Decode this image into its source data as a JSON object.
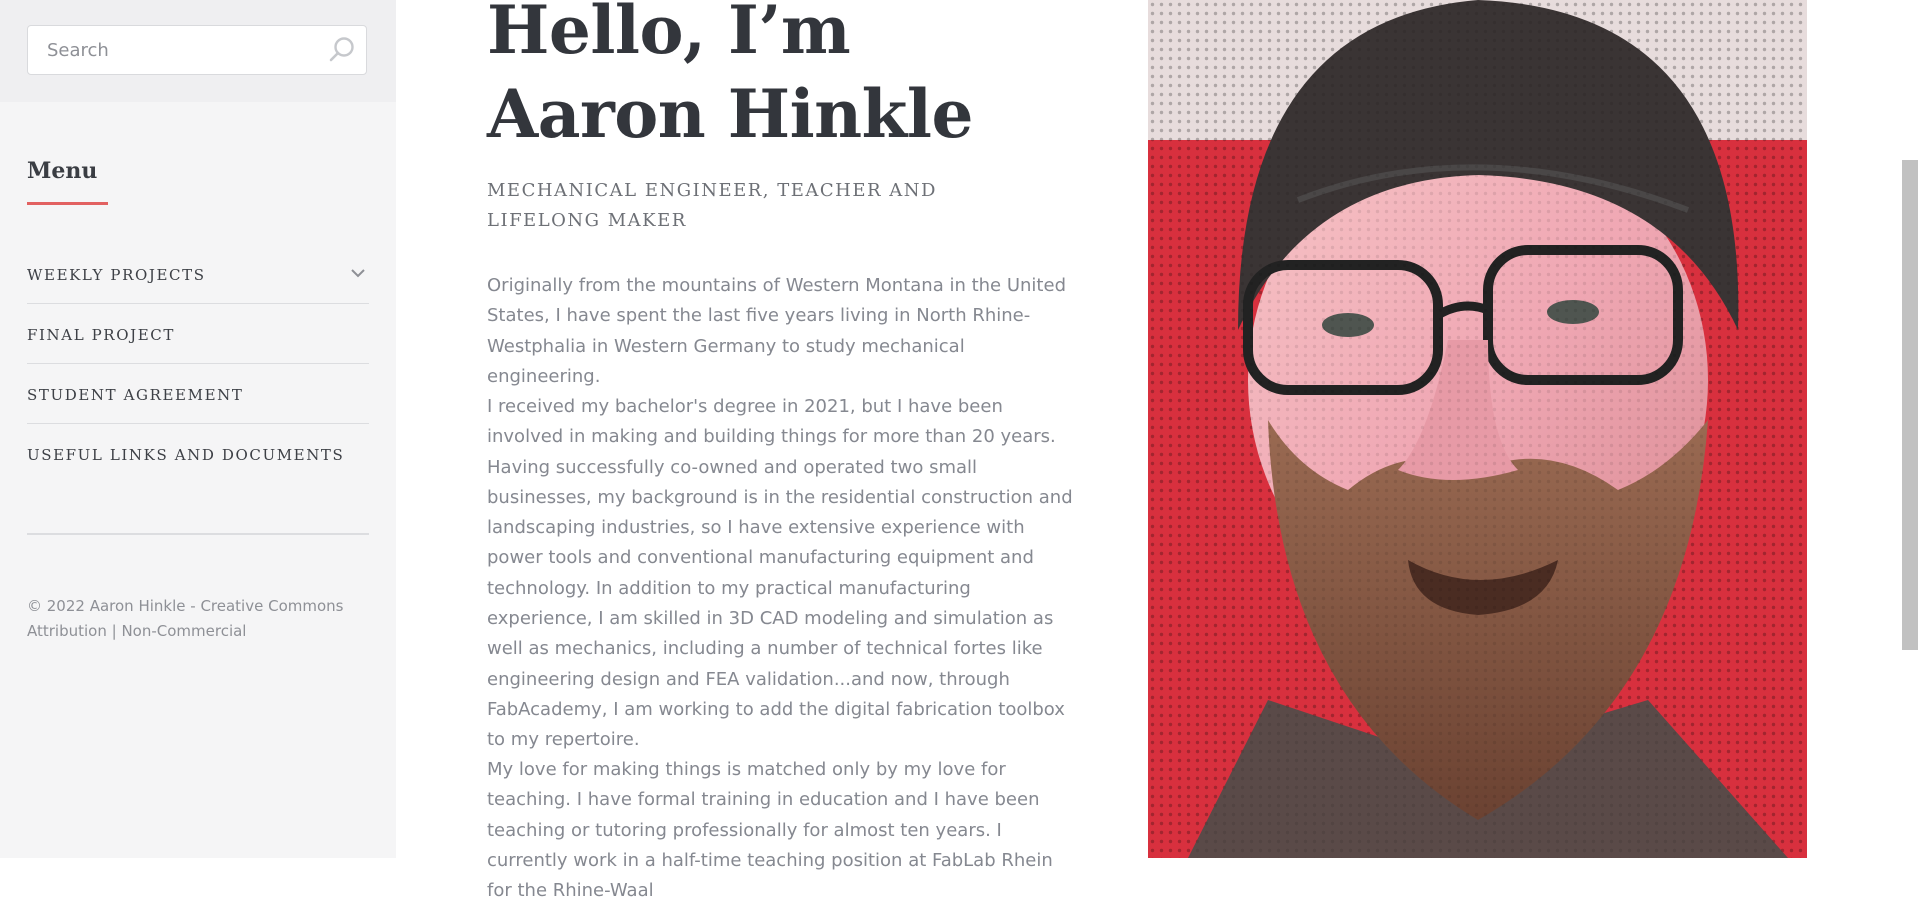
{
  "search": {
    "placeholder": "Search"
  },
  "sidebar": {
    "menu_heading": "Menu",
    "items": [
      {
        "label": "WEEKLY PROJECTS",
        "has_submenu": true,
        "icon": "chevron-down-icon"
      },
      {
        "label": "FINAL PROJECT"
      },
      {
        "label": "STUDENT AGREEMENT"
      },
      {
        "label": "USEFUL LINKS AND DOCUMENTS"
      }
    ],
    "footer": "© 2022 Aaron Hinkle - Creative Commons Attribution | Non-Commercial"
  },
  "main": {
    "title_line1": "Hello, I’m",
    "title_line2": "Aaron Hinkle",
    "subtitle": "MECHANICAL ENGINEER, TEACHER AND LIFELONG MAKER",
    "paragraphs": [
      "Originally from the mountains of Western Montana in the United States, I have spent the last five years living in North Rhine-Westphalia in Western Germany to study mechanical engineering.",
      "I received my bachelor's degree in 2021, but I have been involved in making and building things for more than 20 years. Having successfully co-owned and operated two small businesses, my background is in the residential construction and landscaping industries, so I have extensive experience with power tools and conventional manufacturing equipment and technology. In addition to my practical manufacturing experience, I am skilled in 3D CAD modeling and simulation as well as mechanics, including a number of technical fortes like engineering design and FEA validation...and now, through FabAcademy, I am working to add the digital fabrication toolbox to my repertoire.",
      "My love for making things is matched only by my love for teaching. I have formal training in education and I have been teaching or tutoring professionally for almost ten years. I currently work in a half-time teaching position at FabLab Rhein for the Rhine-Waal"
    ]
  },
  "colors": {
    "accent": "#e26161",
    "sidebar_bg": "#f5f5f6",
    "heading": "#33363c",
    "body_text": "#858890"
  }
}
